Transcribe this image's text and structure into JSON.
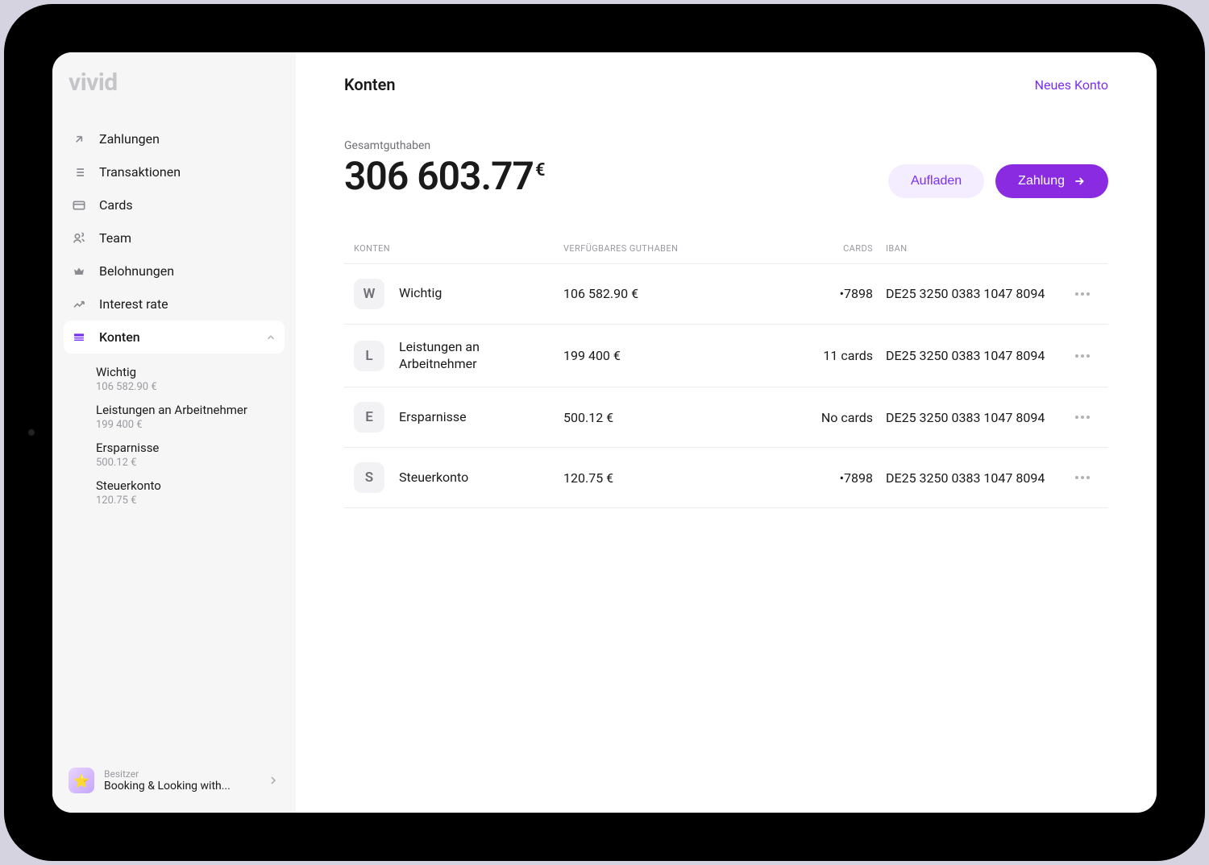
{
  "logo": "vivid",
  "nav": {
    "items": [
      {
        "label": "Zahlungen",
        "icon": "arrow-up-right-icon"
      },
      {
        "label": "Transaktionen",
        "icon": "list-icon"
      },
      {
        "label": "Cards",
        "icon": "card-icon"
      },
      {
        "label": "Team",
        "icon": "users-icon"
      },
      {
        "label": "Belohnungen",
        "icon": "crown-icon"
      },
      {
        "label": "Interest rate",
        "icon": "trend-icon"
      },
      {
        "label": "Konten",
        "icon": "stack-icon",
        "active": true
      }
    ]
  },
  "sidebar_accounts": [
    {
      "name": "Wichtig",
      "balance": "106 582.90 €"
    },
    {
      "name": "Leistungen an Arbeitnehmer",
      "balance": "199 400 €"
    },
    {
      "name": "Ersparnisse",
      "balance": "500.12 €"
    },
    {
      "name": "Steuerkonto",
      "balance": "120.75 €"
    }
  ],
  "footer": {
    "role": "Besitzer",
    "company": "Booking & Looking with..."
  },
  "header": {
    "title": "Konten",
    "new_account": "Neues Konto"
  },
  "total": {
    "label": "Gesamtguthaben",
    "amount": "306 603.77",
    "currency": "€"
  },
  "actions": {
    "topup": "Aufladen",
    "payment": "Zahlung"
  },
  "table": {
    "headers": {
      "account": "KONTEN",
      "available": "VERFÜGBARES GUTHABEN",
      "cards": "CARDS",
      "iban": "IBAN"
    },
    "rows": [
      {
        "letter": "W",
        "name": "Wichtig",
        "available": "106 582.90 €",
        "cards": "•7898",
        "iban": "DE25 3250 0383 1047 8094"
      },
      {
        "letter": "L",
        "name": "Leistungen an Arbeitnehmer",
        "available": "199 400 €",
        "cards": "11 cards",
        "iban": "DE25 3250 0383 1047 8094"
      },
      {
        "letter": "E",
        "name": "Ersparnisse",
        "available": "500.12 €",
        "cards": "No cards",
        "iban": "DE25 3250 0383 1047 8094"
      },
      {
        "letter": "S",
        "name": "Steuerkonto",
        "available": "120.75 €",
        "cards": "•7898",
        "iban": "DE25 3250 0383 1047 8094"
      }
    ]
  }
}
